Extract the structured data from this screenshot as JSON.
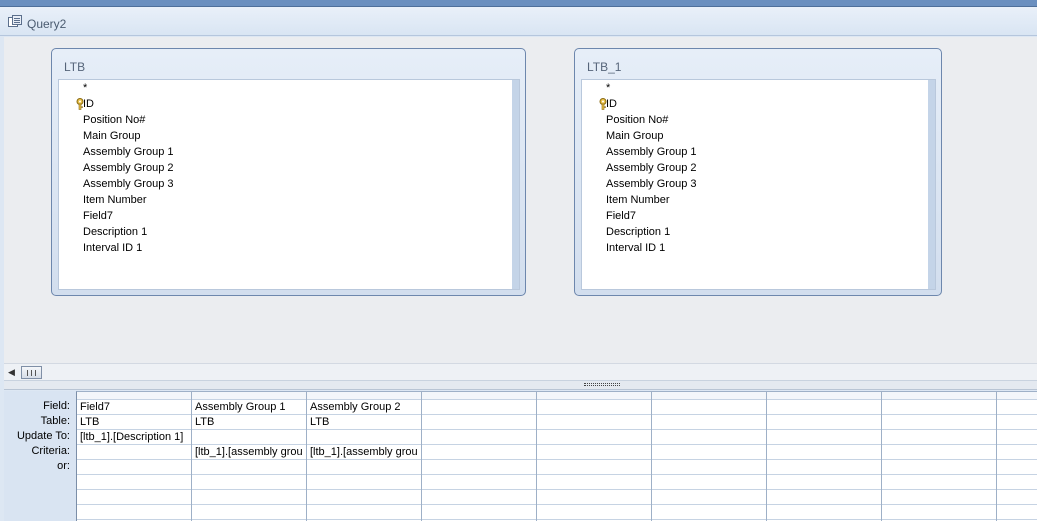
{
  "window": {
    "tab_title": "Query2",
    "tab_icon": "query-icon"
  },
  "tables": [
    {
      "title": "LTB",
      "fields": [
        "*",
        "ID",
        "Position No#",
        "Main Group",
        "Assembly Group 1",
        "Assembly Group 2",
        "Assembly Group 3",
        "Item Number",
        "Field7",
        "Description 1",
        "Interval ID 1"
      ],
      "primary_key": "ID",
      "key_icon": "primary-key-icon"
    },
    {
      "title": "LTB_1",
      "fields": [
        "*",
        "ID",
        "Position No#",
        "Main Group",
        "Assembly Group 1",
        "Assembly Group 2",
        "Assembly Group 3",
        "Item Number",
        "Field7",
        "Description 1",
        "Interval ID 1"
      ],
      "primary_key": "ID",
      "key_icon": "primary-key-icon"
    }
  ],
  "grid": {
    "row_labels": [
      "Field:",
      "Table:",
      "Update To:",
      "Criteria:",
      "or:"
    ],
    "columns": [
      {
        "field": "Field7",
        "table": "LTB",
        "update_to": "[ltb_1].[Description 1]",
        "criteria": "",
        "or": ""
      },
      {
        "field": "Assembly Group 1",
        "table": "LTB",
        "update_to": "",
        "criteria": "[ltb_1].[assembly grou",
        "or": ""
      },
      {
        "field": "Assembly Group 2",
        "table": "LTB",
        "update_to": "",
        "criteria": "[ltb_1].[assembly grou",
        "or": ""
      },
      {
        "field": "",
        "table": "",
        "update_to": "",
        "criteria": "",
        "or": ""
      },
      {
        "field": "",
        "table": "",
        "update_to": "",
        "criteria": "",
        "or": ""
      },
      {
        "field": "",
        "table": "",
        "update_to": "",
        "criteria": "",
        "or": ""
      },
      {
        "field": "",
        "table": "",
        "update_to": "",
        "criteria": "",
        "or": ""
      },
      {
        "field": "",
        "table": "",
        "update_to": "",
        "criteria": "",
        "or": ""
      },
      {
        "field": "",
        "table": "",
        "update_to": "",
        "criteria": "",
        "or": ""
      }
    ]
  },
  "scrollbar": {
    "left_arrow": "◀"
  }
}
